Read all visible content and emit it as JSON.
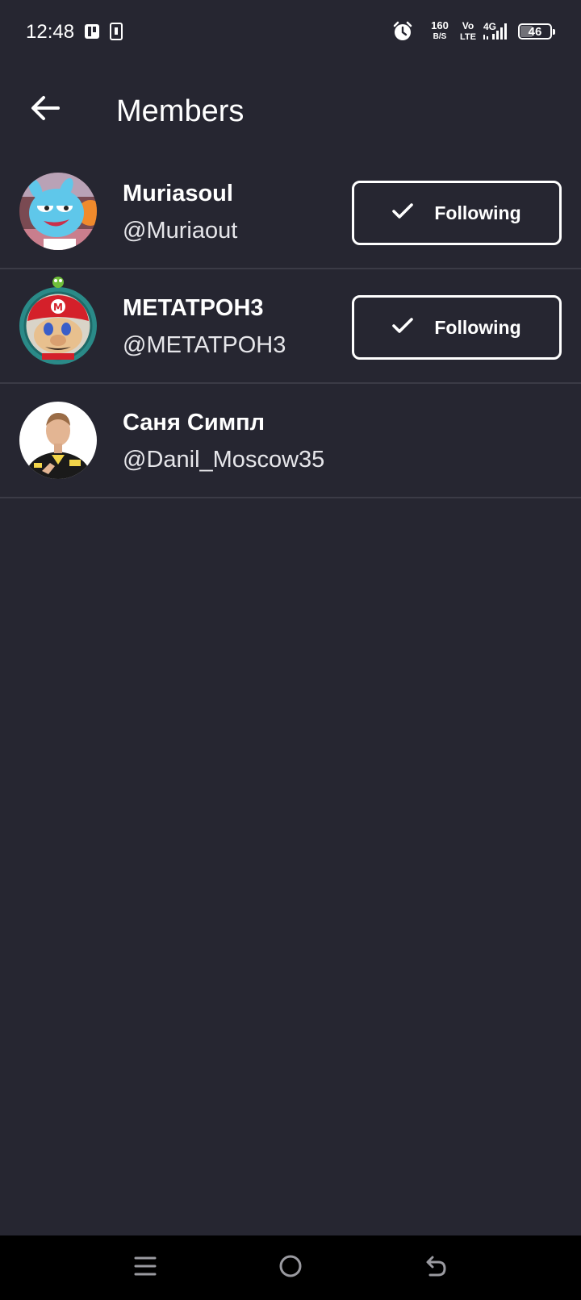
{
  "status_bar": {
    "time": "12:48",
    "network_speed_value": "160",
    "network_speed_unit": "B/S",
    "volte_top": "Vo",
    "volte_bottom": "LTE",
    "network_type": "4G",
    "battery_percent": "46",
    "battery_level": 0.46,
    "icons": [
      "notification-app-icon",
      "notification-device-icon",
      "alarm-icon",
      "signal-icon",
      "battery-icon"
    ]
  },
  "header": {
    "title": "Members",
    "back_icon": "arrow-left-icon"
  },
  "members": [
    {
      "name": "Muriasoul",
      "handle": "@Muriaout",
      "following": true,
      "button_label": "Following",
      "avatar": "cartoon-blue-cat"
    },
    {
      "name": "METATPOH3",
      "handle": "@METATPOH3",
      "following": true,
      "button_label": "Following",
      "avatar": "red-cap-character"
    },
    {
      "name": "Саня Симпл",
      "handle": "@Danil_Moscow35",
      "following": false,
      "button_label": "",
      "avatar": "person-photo"
    }
  ],
  "nav_bar": {
    "icons": [
      "menu-icon",
      "home-circle-icon",
      "back-return-icon"
    ]
  },
  "colors": {
    "background": "#262631",
    "divider": "#3b3b46",
    "text": "#ffffff",
    "nav_background": "#000000"
  }
}
